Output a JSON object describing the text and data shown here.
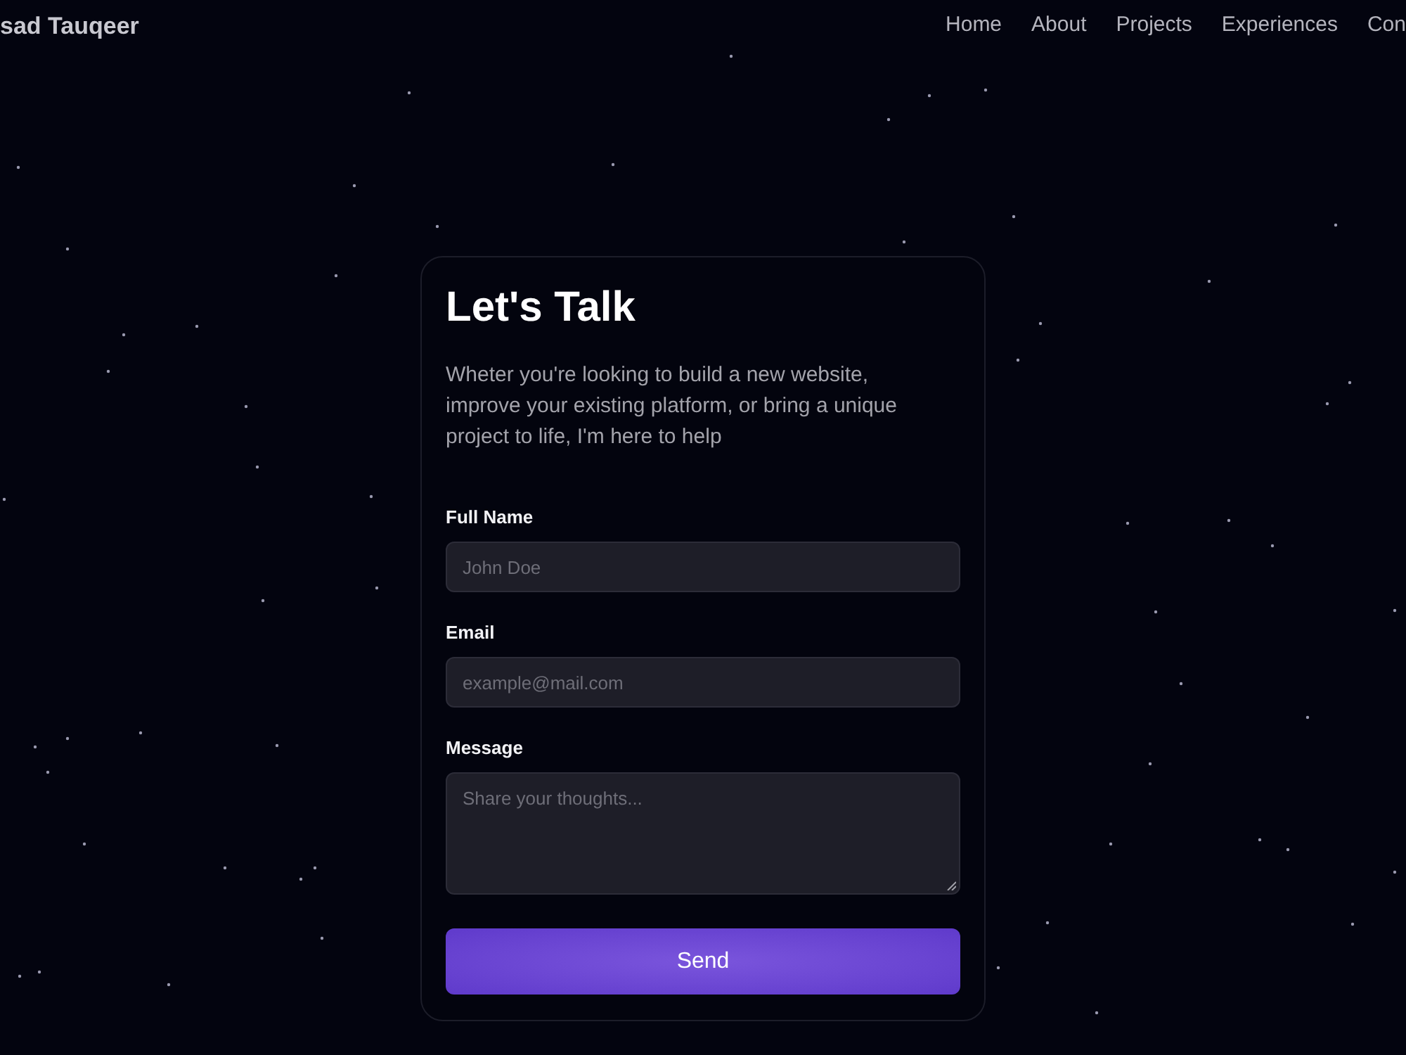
{
  "header": {
    "logo": "sad Tauqeer",
    "nav": [
      "Home",
      "About",
      "Projects",
      "Experiences",
      "Con"
    ]
  },
  "contact_card": {
    "title": "Let's Talk",
    "description": "Wheter you're looking to build a new website, improve your existing platform, or bring a unique project to life, I'm here to help",
    "fields": [
      {
        "kind": "text",
        "label": "Full Name",
        "placeholder": "John Doe"
      },
      {
        "kind": "email",
        "label": "Email",
        "placeholder": "example@mail.com"
      },
      {
        "kind": "textarea",
        "label": "Message",
        "placeholder": "Share your thoughts..."
      }
    ],
    "submit": "Send"
  }
}
